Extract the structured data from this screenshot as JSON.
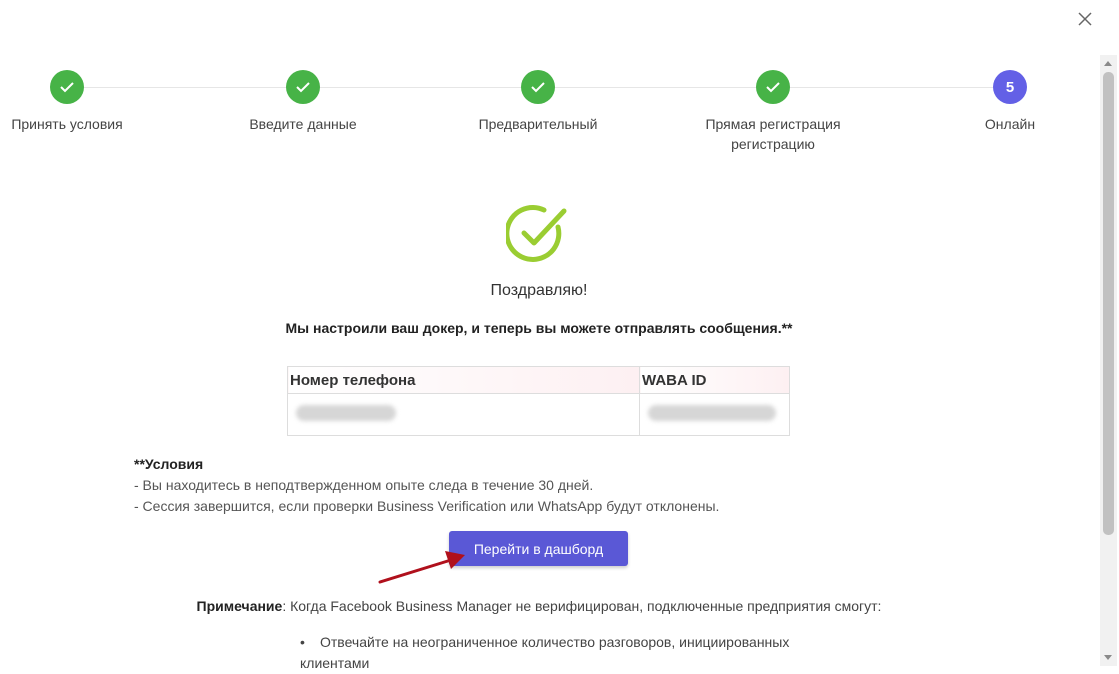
{
  "dialog": {
    "close_icon": "close-icon",
    "steps": [
      {
        "label": "Принять условия",
        "status": "done"
      },
      {
        "label": "Введите данные",
        "status": "done"
      },
      {
        "label": "Предварительный",
        "status": "done"
      },
      {
        "label_line1": "Прямая регистрация",
        "label_line2": "регистрацию",
        "status": "done"
      },
      {
        "label": "Онлайн",
        "number": "5",
        "status": "active"
      }
    ],
    "success_icon": "check-circle-icon",
    "title": "Поздравляю!",
    "subtitle": "Мы настроили ваш докер, и теперь вы можете отправлять сообщения.**",
    "table": {
      "headers": [
        "Номер телефона",
        "WABA ID"
      ]
    },
    "terms": {
      "heading": "**Условия",
      "items": [
        "- Вы находитесь в неподтвержденном опыте следа в течение 30 дней.",
        "- Сессия завершится, если проверки Business Verification или WhatsApp будут отклонены."
      ]
    },
    "cta_label": "Перейти в дашборд",
    "note": {
      "label": "Примечание",
      "text": ": Когда Facebook Business Manager не верифицирован, подключенные предприятия смогут:"
    },
    "bullets": [
      {
        "line1": "Отвечайте на неограниченное количество разговоров, инициированных",
        "line2": "клиентами"
      }
    ]
  },
  "colors": {
    "step_done": "#47b347",
    "step_active": "#6360e6",
    "success_icon": "#9acd32",
    "cta": "#5a58d6",
    "annotation_arrow": "#b0101c"
  }
}
